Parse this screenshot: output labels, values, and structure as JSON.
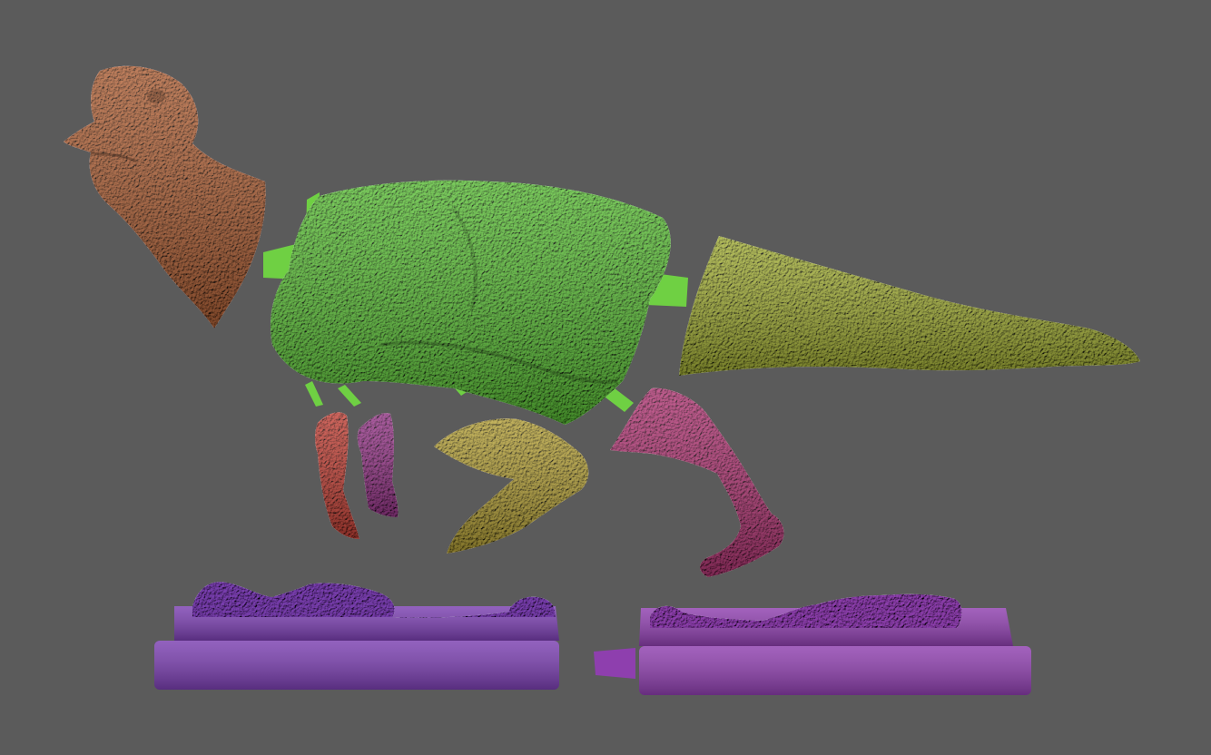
{
  "scene": {
    "background_color": "#5b5b5b",
    "parts": [
      {
        "name": "head-neck-part",
        "color": "#b5653a"
      },
      {
        "name": "torso-part",
        "color": "#5fc43a"
      },
      {
        "name": "torso-connector-pegs",
        "color": "#6fd043"
      },
      {
        "name": "tail-part",
        "color": "#a8b43a"
      },
      {
        "name": "right-arm-part",
        "color": "#c9453a"
      },
      {
        "name": "left-arm-part",
        "color": "#9c3a8e"
      },
      {
        "name": "near-leg-thigh-part",
        "color": "#b8a43a"
      },
      {
        "name": "far-leg-part",
        "color": "#b63a78"
      },
      {
        "name": "base-left-part",
        "color": "#7a3fb0"
      },
      {
        "name": "base-right-part",
        "color": "#8e3fae"
      }
    ]
  }
}
